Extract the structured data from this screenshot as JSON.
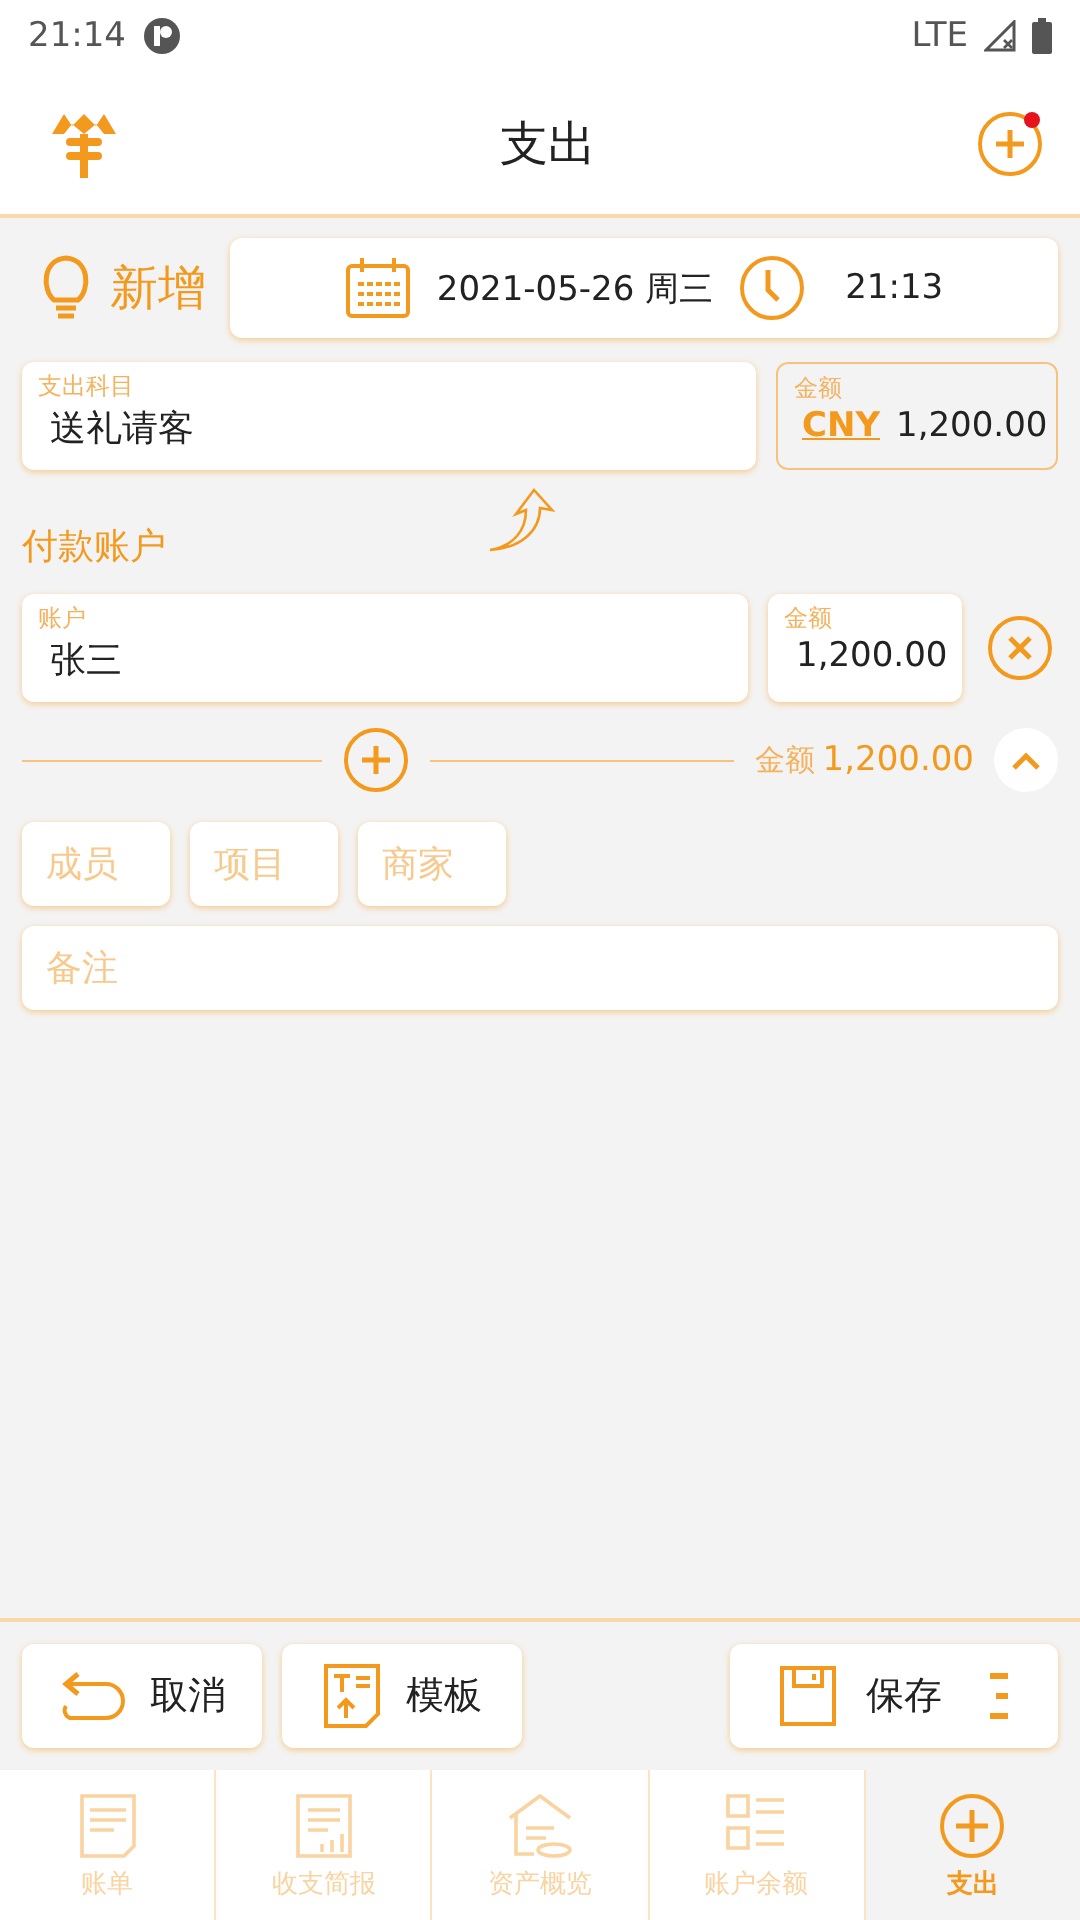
{
  "status_bar": {
    "time": "21:14",
    "network": "LTE"
  },
  "app_bar": {
    "title": "支出",
    "has_notification": true
  },
  "header": {
    "mode": "新增",
    "date": "2021-05-26 周三",
    "time": "21:13"
  },
  "category": {
    "label": "支出科目",
    "value": "送礼请客"
  },
  "amount": {
    "label": "金额",
    "currency": "CNY",
    "value": "1,200.00"
  },
  "payment": {
    "title": "付款账户",
    "accounts": [
      {
        "label": "账户",
        "value": "张三",
        "amount_label": "金额",
        "amount": "1,200.00"
      }
    ],
    "total_label": "金额",
    "total": "1,200.00",
    "expanded": true
  },
  "tags": [
    {
      "placeholder": "成员"
    },
    {
      "placeholder": "项目"
    },
    {
      "placeholder": "商家"
    }
  ],
  "note": {
    "placeholder": "备注"
  },
  "actions": [
    {
      "kind": "cancel",
      "label": "取消"
    },
    {
      "kind": "template",
      "label": "模板"
    },
    {
      "kind": "save",
      "label": "保存"
    }
  ],
  "nav": [
    {
      "kind": "bill",
      "label": "账单",
      "selected": false
    },
    {
      "kind": "report",
      "label": "收支简报",
      "selected": false
    },
    {
      "kind": "assets",
      "label": "资产概览",
      "selected": false
    },
    {
      "kind": "balance",
      "label": "账户余额",
      "selected": false
    },
    {
      "kind": "add",
      "label": "支出",
      "selected": true
    }
  ]
}
